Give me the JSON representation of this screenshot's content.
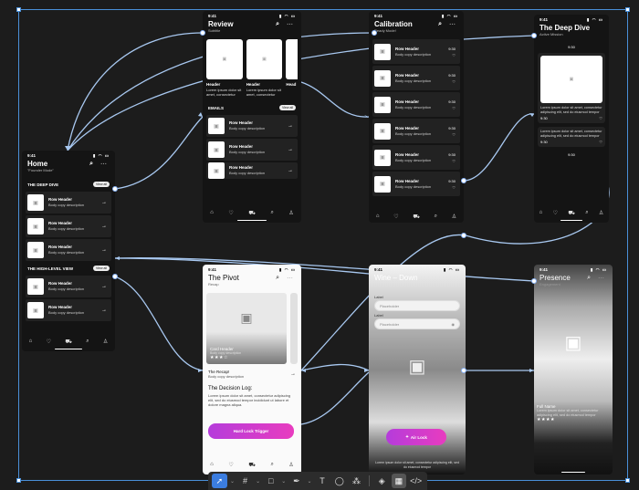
{
  "home": {
    "time": "9:41",
    "title": "Home",
    "subtitle": "\"Founder Mode\"",
    "section1": "THE DEEP DIVE",
    "section1_action": "View all",
    "section2": "THE HIGH-LEVEL VIEW",
    "section2_action": "View all",
    "row_header": "Row Header",
    "row_body": "Body copy description"
  },
  "review": {
    "time": "9:41",
    "title": "Review",
    "subtitle": "Subtitle",
    "card_header": "Header",
    "card_header_cut": "Head",
    "card_body": "Lorem ipsum dolor sit amet, consectetur",
    "section": "EMAILS",
    "section_action": "View all",
    "row_header": "Row Header",
    "row_body": "Body copy description"
  },
  "calibration": {
    "time": "9:41",
    "title": "Calibration",
    "subtitle": "Ready Mode!",
    "row_header": "Row Header",
    "row_body": "Body copy description",
    "row_time": "9:30"
  },
  "deepdive": {
    "time": "9:41",
    "title": "The Deep Dive",
    "subtitle": "Active Mission",
    "time_label": "9:30",
    "body": "Lorem ipsum dolor sit amet, consectetur adipiscing elit, sed do eiusmod tempor"
  },
  "pivot": {
    "time": "9:41",
    "title": "The Pivot",
    "subtitle": "Recap",
    "card_title": "Card Header",
    "card_body": "Body copy description",
    "recap_header": "The Recap!",
    "recap_body": "Body copy description",
    "decision_title": "The Decision Log:",
    "decision_body": "Lorem ipsum dolor sit amet, consectetur adipiscing elit, sed do eiusmod tempor incididunt ut labore et dolore magna aliqua.",
    "button": "Hard Lock Trigger"
  },
  "wine": {
    "time": "9:41",
    "title": "Wine – Down",
    "label": "Label",
    "placeholder": "Placeholder",
    "button": "Air Lock",
    "footer": "Lorem ipsum dolor sit amet, consectetur adipiscing elit, sed do eiusmod tempor"
  },
  "presence": {
    "time": "9:41",
    "title": "Presence",
    "subtitle": "Engagement",
    "name": "Full Name",
    "body": "Lorem ipsum dolor sit amet, consectetur adipiscing elit, sed do eiusmod tempor"
  },
  "colors": {
    "canvas": "#1c1c1c",
    "selection": "#4a90d9",
    "wire": "#a8c8f0",
    "button_gradient_start": "#b53cdb",
    "button_gradient_end": "#e83cbf",
    "tool_active": "#3b7de0"
  },
  "toolbar": {
    "tools": [
      "move-tool",
      "frame-tool",
      "shape-tool",
      "pen-tool",
      "text-tool",
      "comment-tool",
      "components-tool",
      "dev-mode-tool",
      "prototype-tool",
      "code-tool"
    ]
  }
}
